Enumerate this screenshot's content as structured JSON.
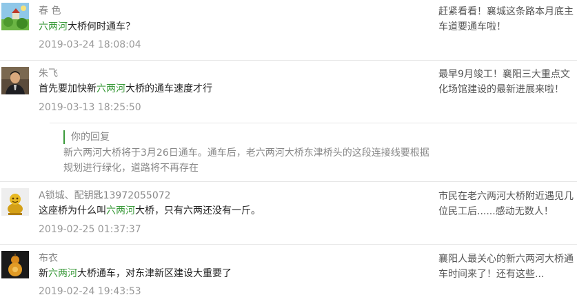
{
  "comments": [
    {
      "name": "春 色",
      "text_before": "",
      "text_highlight": "六两河",
      "text_after": "大桥何时通车？",
      "time": "2019-03-24 18:08:04",
      "avatar_icon": "landscape-avatar-icon"
    },
    {
      "name": "朱飞",
      "text_before": "首先要加快新",
      "text_highlight": "六两河",
      "text_after": "大桥的通车速度才行",
      "time": "2019-03-13 18:25:50",
      "avatar_icon": "person-avatar-icon"
    },
    {
      "name": "A锁城、配钥匙13972055072",
      "text_before": "这座桥为什么叫",
      "text_highlight": "六两河",
      "text_after": "大桥，只有六两还没有一斤。",
      "time": "2019-02-25 01:37:37",
      "avatar_icon": "golden-figure-avatar-icon"
    },
    {
      "name": "布衣",
      "text_before": "新",
      "text_highlight": "六两河",
      "text_after": "大桥通车，对东津新区建设大重要了",
      "time": "2019-02-24 19:43:53",
      "avatar_icon": "gourd-avatar-icon"
    }
  ],
  "reply": {
    "label": "你的回复",
    "text": "新六两河大桥将于3月26日通车。通车后，老六两河大桥东津桥头的这段连接线要根据规划进行绿化，道路将不再存在"
  },
  "side_links": [
    "赶紧看看！襄城这条路本月底主车道要通车啦！",
    "最早9月竣工！襄阳三大重点文化场馆建设的最新进展来啦！",
    "市民在老六两河大桥附近遇见几位民工后......感动无数人！",
    "襄阳人最关心的新六两河大桥通车时间来了！还有这些..."
  ],
  "colors": {
    "highlight": "#3a9a3a",
    "divider": "#e6e6e6"
  }
}
